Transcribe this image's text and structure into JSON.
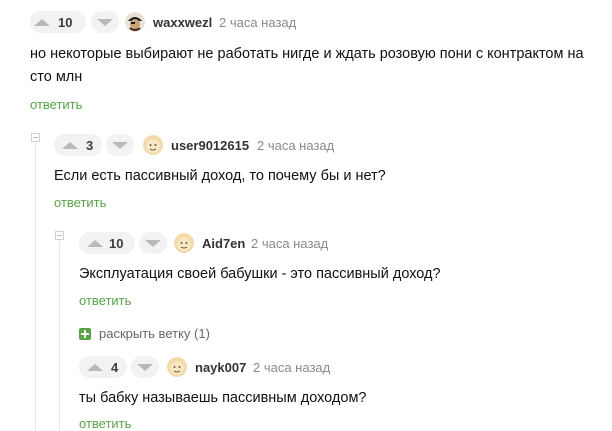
{
  "comments": [
    {
      "rating": "10",
      "username": "waxxwezl",
      "time": "2 часа назад",
      "text": "но некоторые выбирают не работать нигде и ждать розовую пони с контрактом на сто млн",
      "reply": "ответить"
    },
    {
      "rating": "3",
      "username": "user9012615",
      "time": "2 часа назад",
      "text": "Если есть пассивный доход, то почему бы и нет?",
      "reply": "ответить"
    },
    {
      "rating": "10",
      "username": "Aid7en",
      "time": "2 часа назад",
      "text": "Эксплуатация своей бабушки - это пассивный доход?",
      "reply": "ответить",
      "expand_branch": "раскрыть ветку (1)"
    },
    {
      "rating": "4",
      "username": "nayk007",
      "time": "2 часа назад",
      "text": "ты бабку называешь пассивным доходом?",
      "reply": "ответить"
    }
  ],
  "colors": {
    "accent_green": "#55a744",
    "muted": "#8a8a8a"
  }
}
